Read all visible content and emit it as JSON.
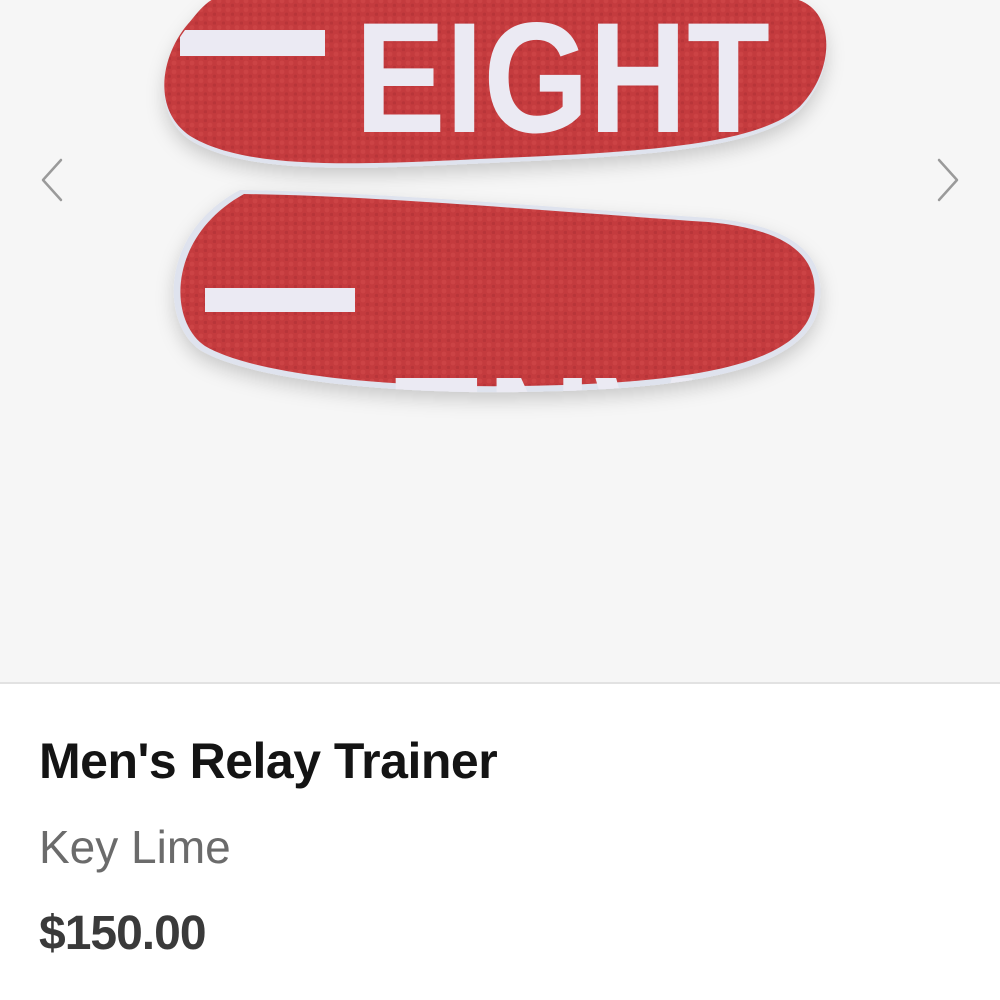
{
  "gallery": {
    "image": {
      "icon": "insole-product-photo",
      "top_insole_text": "EIGHT",
      "bottom_insole_text": "LANE",
      "insole_color": "#c33a3d",
      "print_color": "#e9e8f2"
    },
    "prev_icon": "chevron-left-icon",
    "next_icon": "chevron-right-icon"
  },
  "product": {
    "title": "Men's Relay Trainer",
    "color": "Key Lime",
    "price": "$150.00"
  }
}
